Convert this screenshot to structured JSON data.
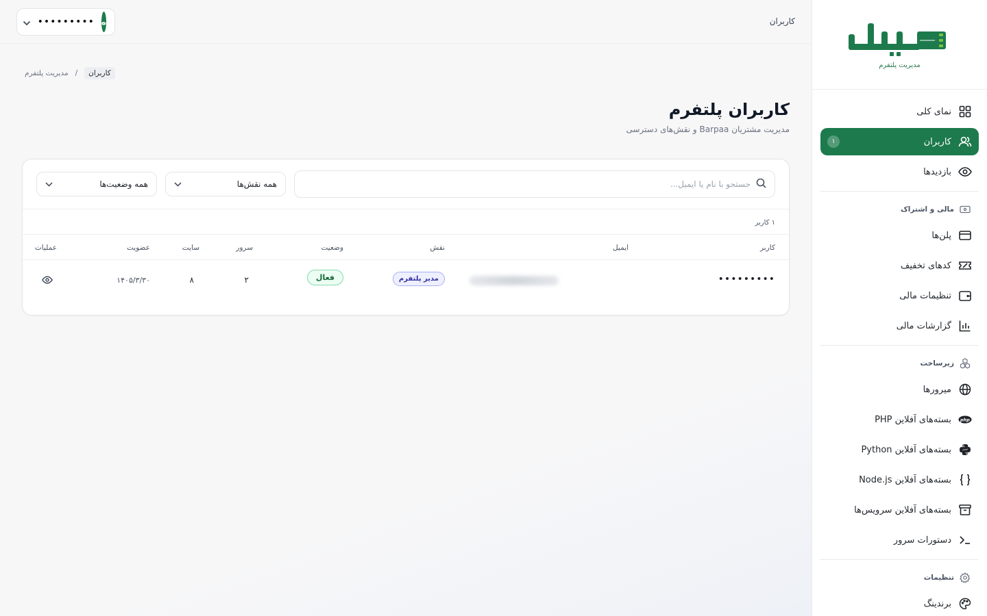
{
  "brand": {
    "logo_text": "بریا",
    "tagline": "مدیریت پلتفرم",
    "primary_color": "#1d7a4c",
    "accent_color": "#7ac142"
  },
  "topbar": {
    "title": "کاربران",
    "user_name": "•••••••••",
    "avatar_initial": "ه"
  },
  "sidebar": {
    "items": [
      {
        "label": "نمای کلی",
        "icon": "grid-icon"
      },
      {
        "label": "کاربران",
        "icon": "users-icon",
        "badge": "۱",
        "active": true
      },
      {
        "label": "بازدیدها",
        "icon": "eye-icon"
      }
    ],
    "finance": {
      "title": "مالی و اشتراک",
      "items": [
        {
          "label": "پلن‌ها",
          "icon": "card-icon"
        },
        {
          "label": "کدهای تخفیف",
          "icon": "ticket-icon"
        },
        {
          "label": "تنظیمات مالی",
          "icon": "wallet-icon"
        },
        {
          "label": "گزارشات مالی",
          "icon": "bar-chart-icon"
        }
      ]
    },
    "infra": {
      "title": "زیرساخت",
      "items": [
        {
          "label": "میرورها",
          "icon": "globe-icon"
        },
        {
          "label": "بسته‌های آفلاین PHP",
          "icon": "php-icon"
        },
        {
          "label": "بسته‌های آفلاین Python",
          "icon": "python-icon"
        },
        {
          "label": "بسته‌های آفلاین Node.js",
          "icon": "braces-icon"
        },
        {
          "label": "بسته‌های آفلاین سرویس‌ها",
          "icon": "archive-icon"
        },
        {
          "label": "دستورات سرور",
          "icon": "terminal-icon"
        }
      ]
    },
    "settings": {
      "title": "تنظیمات",
      "items": [
        {
          "label": "برندینگ",
          "icon": "palette-icon"
        }
      ]
    }
  },
  "breadcrumb": {
    "root": "مدیریت پلتفرم",
    "separator": "/",
    "current": "کاربران"
  },
  "page": {
    "title": "کاربران پلتفرم",
    "subtitle": "مدیریت مشتریان Barpaa و نقش‌های دسترسی"
  },
  "filters": {
    "search_placeholder": "جستجو با نام یا ایمیل...",
    "roles_selected": "همه نقش‌ها",
    "status_selected": "همه وضعیت‌ها"
  },
  "table": {
    "count_text": "۱ کاربر",
    "headers": {
      "user": "کاربر",
      "email": "ایمیل",
      "role": "نقش",
      "status": "وضعیت",
      "server": "سرور",
      "site": "سایت",
      "membership": "عضویت",
      "actions": "عملیات"
    },
    "rows": [
      {
        "user": "•••••••••",
        "role": "مدیر پلتفرم",
        "status": "فعال",
        "server": "۲",
        "site": "۸",
        "membership": "۱۴۰۵/۳/۳۰"
      }
    ]
  }
}
